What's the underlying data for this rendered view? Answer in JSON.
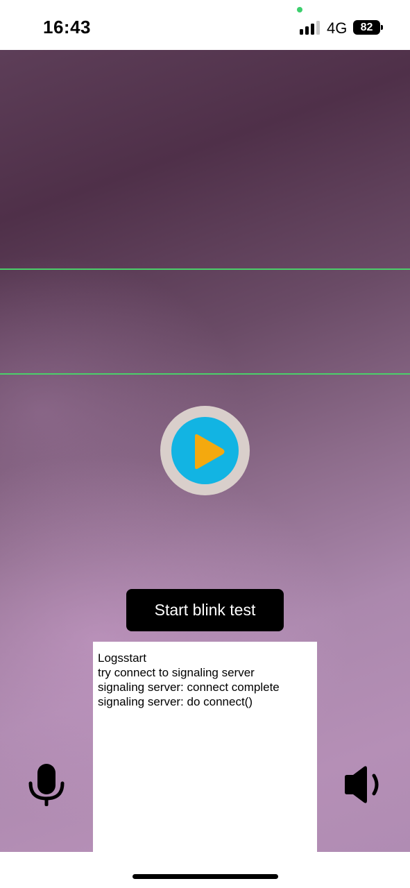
{
  "status_bar": {
    "time": "16:43",
    "network": "4G",
    "battery": "82",
    "signal_bars": 3,
    "privacy_indicator_color": "#3ccf6d"
  },
  "camera": {
    "guide_line_color": "#4bd06a"
  },
  "play_button": {
    "icon": "play-icon",
    "ring_color": "#d9cfcb",
    "circle_color": "#12b4e3",
    "triangle_color": "#f4a90e"
  },
  "start_button": {
    "label": "Start blink test"
  },
  "log": {
    "lines": [
      "Logsstart",
      "try connect to signaling server",
      "signaling server: connect complete",
      "signaling server: do connect()"
    ]
  },
  "controls": {
    "mic_icon": "microphone-icon",
    "speaker_icon": "speaker-icon"
  }
}
